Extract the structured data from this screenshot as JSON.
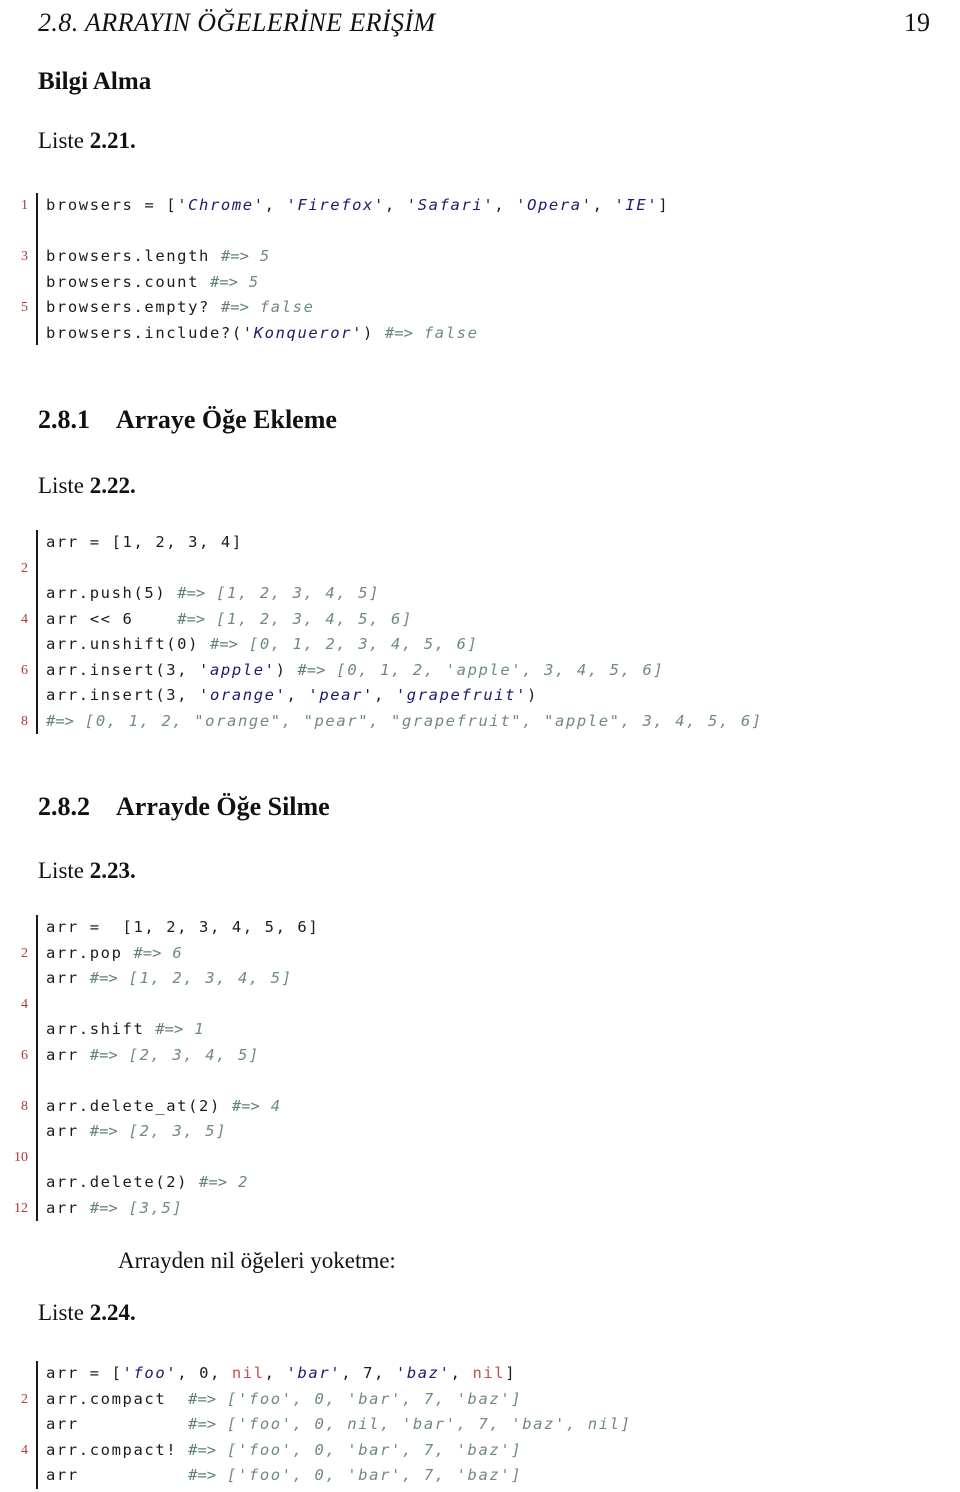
{
  "header": {
    "title": "2.8.  ARRAYIN ÖĞELERİNE ERİŞİM",
    "page_number": "19"
  },
  "colors": {
    "string": "#1b1a6e",
    "comment": "#6f8a86",
    "keyword": "#c0504d",
    "linenumber": "#b03a3a",
    "text": "#111111",
    "background": "#ffffff"
  },
  "sections": {
    "bilgi_alma_title": "Bilgi Alma",
    "listing_21_label_word": "Liste ",
    "listing_21_label_num": "2.21.",
    "subsec_1_num": "2.8.1",
    "subsec_1_title": "Arraye Öğe Ekleme",
    "listing_22_label_word": "Liste ",
    "listing_22_label_num": "2.22.",
    "subsec_2_num": "2.8.2",
    "subsec_2_title": "Arrayde Öğe Silme",
    "listing_23_label_word": "Liste ",
    "listing_23_label_num": "2.23.",
    "nil_paragraph": "Arrayden nil öğeleri yoketme:",
    "listing_24_label_word": "Liste ",
    "listing_24_label_num": "2.24."
  },
  "listing_21": {
    "lines": [
      {
        "n": "1",
        "tokens": [
          {
            "t": "browsers = [",
            "c": "plain"
          },
          {
            "t": "'Chrome'",
            "c": "str"
          },
          {
            "t": ", ",
            "c": "plain"
          },
          {
            "t": "'Firefox'",
            "c": "str"
          },
          {
            "t": ", ",
            "c": "plain"
          },
          {
            "t": "'Safari'",
            "c": "str"
          },
          {
            "t": ", ",
            "c": "plain"
          },
          {
            "t": "'Opera'",
            "c": "str"
          },
          {
            "t": ", ",
            "c": "plain"
          },
          {
            "t": "'IE'",
            "c": "str"
          },
          {
            "t": "]",
            "c": "plain"
          }
        ]
      },
      {
        "n": "",
        "tokens": []
      },
      {
        "n": "3",
        "tokens": [
          {
            "t": "browsers.length ",
            "c": "plain"
          },
          {
            "t": "#=>",
            "c": "arrow"
          },
          {
            "t": " 5",
            "c": "cmt"
          }
        ]
      },
      {
        "n": "",
        "tokens": [
          {
            "t": "browsers.count ",
            "c": "plain"
          },
          {
            "t": "#=>",
            "c": "arrow"
          },
          {
            "t": " 5",
            "c": "cmt"
          }
        ]
      },
      {
        "n": "5",
        "tokens": [
          {
            "t": "browsers.empty? ",
            "c": "plain"
          },
          {
            "t": "#=>",
            "c": "arrow"
          },
          {
            "t": " false",
            "c": "cmt"
          }
        ]
      },
      {
        "n": "",
        "tokens": [
          {
            "t": "browsers.include?(",
            "c": "plain"
          },
          {
            "t": "'Konqueror'",
            "c": "str"
          },
          {
            "t": ") ",
            "c": "plain"
          },
          {
            "t": "#=>",
            "c": "arrow"
          },
          {
            "t": " false",
            "c": "cmt"
          }
        ]
      }
    ]
  },
  "listing_22": {
    "lines": [
      {
        "n": "",
        "tokens": [
          {
            "t": "arr = [1, 2, 3, 4]",
            "c": "plain"
          }
        ]
      },
      {
        "n": "2",
        "tokens": []
      },
      {
        "n": "",
        "tokens": [
          {
            "t": "arr.push(5) ",
            "c": "plain"
          },
          {
            "t": "#=>",
            "c": "arrow"
          },
          {
            "t": " [1, 2, 3, 4, 5]",
            "c": "cmt"
          }
        ]
      },
      {
        "n": "4",
        "tokens": [
          {
            "t": "arr << 6    ",
            "c": "plain"
          },
          {
            "t": "#=>",
            "c": "arrow"
          },
          {
            "t": " [1, 2, 3, 4, 5, 6]",
            "c": "cmt"
          }
        ]
      },
      {
        "n": "",
        "tokens": [
          {
            "t": "arr.unshift(0) ",
            "c": "plain"
          },
          {
            "t": "#=>",
            "c": "arrow"
          },
          {
            "t": " [0, 1, 2, 3, 4, 5, 6]",
            "c": "cmt"
          }
        ]
      },
      {
        "n": "6",
        "tokens": [
          {
            "t": "arr.insert(3, ",
            "c": "plain"
          },
          {
            "t": "'apple'",
            "c": "str"
          },
          {
            "t": ") ",
            "c": "plain"
          },
          {
            "t": "#=>",
            "c": "arrow"
          },
          {
            "t": " [0, 1, 2, 'apple', 3, 4, 5, 6]",
            "c": "cmt"
          }
        ]
      },
      {
        "n": "",
        "tokens": [
          {
            "t": "arr.insert(3, ",
            "c": "plain"
          },
          {
            "t": "'orange'",
            "c": "str"
          },
          {
            "t": ", ",
            "c": "plain"
          },
          {
            "t": "'pear'",
            "c": "str"
          },
          {
            "t": ", ",
            "c": "plain"
          },
          {
            "t": "'grapefruit'",
            "c": "str"
          },
          {
            "t": ")",
            "c": "plain"
          }
        ]
      },
      {
        "n": "8",
        "tokens": [
          {
            "t": "#=>",
            "c": "arrow"
          },
          {
            "t": " [0, 1, 2, \"orange\", \"pear\", \"grapefruit\", \"apple\", 3, 4, 5, 6]",
            "c": "cmt"
          }
        ]
      }
    ]
  },
  "listing_23": {
    "lines": [
      {
        "n": "",
        "tokens": [
          {
            "t": "arr =  [1, 2, 3, 4, 5, 6]",
            "c": "plain"
          }
        ]
      },
      {
        "n": "2",
        "tokens": [
          {
            "t": "arr.pop ",
            "c": "plain"
          },
          {
            "t": "#=>",
            "c": "arrow"
          },
          {
            "t": " 6",
            "c": "cmt"
          }
        ]
      },
      {
        "n": "",
        "tokens": [
          {
            "t": "arr ",
            "c": "plain"
          },
          {
            "t": "#=>",
            "c": "arrow"
          },
          {
            "t": " [1, 2, 3, 4, 5]",
            "c": "cmt"
          }
        ]
      },
      {
        "n": "4",
        "tokens": []
      },
      {
        "n": "",
        "tokens": [
          {
            "t": "arr.shift ",
            "c": "plain"
          },
          {
            "t": "#=>",
            "c": "arrow"
          },
          {
            "t": " 1",
            "c": "cmt"
          }
        ]
      },
      {
        "n": "6",
        "tokens": [
          {
            "t": "arr ",
            "c": "plain"
          },
          {
            "t": "#=>",
            "c": "arrow"
          },
          {
            "t": " [2, 3, 4, 5]",
            "c": "cmt"
          }
        ]
      },
      {
        "n": "",
        "tokens": []
      },
      {
        "n": "8",
        "tokens": [
          {
            "t": "arr.delete_at(2) ",
            "c": "plain"
          },
          {
            "t": "#=>",
            "c": "arrow"
          },
          {
            "t": " 4",
            "c": "cmt"
          }
        ]
      },
      {
        "n": "",
        "tokens": [
          {
            "t": "arr ",
            "c": "plain"
          },
          {
            "t": "#=>",
            "c": "arrow"
          },
          {
            "t": " [2, 3, 5]",
            "c": "cmt"
          }
        ]
      },
      {
        "n": "10",
        "tokens": []
      },
      {
        "n": "",
        "tokens": [
          {
            "t": "arr.delete(2) ",
            "c": "plain"
          },
          {
            "t": "#=>",
            "c": "arrow"
          },
          {
            "t": " 2",
            "c": "cmt"
          }
        ]
      },
      {
        "n": "12",
        "tokens": [
          {
            "t": "arr ",
            "c": "plain"
          },
          {
            "t": "#=>",
            "c": "arrow"
          },
          {
            "t": " [3,5]",
            "c": "cmt"
          }
        ]
      }
    ]
  },
  "listing_24": {
    "lines": [
      {
        "n": "",
        "tokens": [
          {
            "t": "arr = [",
            "c": "plain"
          },
          {
            "t": "'foo'",
            "c": "str"
          },
          {
            "t": ", 0, ",
            "c": "plain"
          },
          {
            "t": "nil",
            "c": "kw"
          },
          {
            "t": ", ",
            "c": "plain"
          },
          {
            "t": "'bar'",
            "c": "str"
          },
          {
            "t": ", 7, ",
            "c": "plain"
          },
          {
            "t": "'baz'",
            "c": "str"
          },
          {
            "t": ", ",
            "c": "plain"
          },
          {
            "t": "nil",
            "c": "kw"
          },
          {
            "t": "]",
            "c": "plain"
          }
        ]
      },
      {
        "n": "2",
        "tokens": [
          {
            "t": "arr.compact  ",
            "c": "plain"
          },
          {
            "t": "#=>",
            "c": "arrow"
          },
          {
            "t": " ['foo', 0, 'bar', 7, 'baz']",
            "c": "cmt"
          }
        ]
      },
      {
        "n": "",
        "tokens": [
          {
            "t": "arr          ",
            "c": "plain"
          },
          {
            "t": "#=>",
            "c": "arrow"
          },
          {
            "t": " ['foo', 0, nil, 'bar', 7, 'baz', nil]",
            "c": "cmt"
          }
        ]
      },
      {
        "n": "4",
        "tokens": [
          {
            "t": "arr.compact! ",
            "c": "plain"
          },
          {
            "t": "#=>",
            "c": "arrow"
          },
          {
            "t": " ['foo', 0, 'bar', 7, 'baz']",
            "c": "cmt"
          }
        ]
      },
      {
        "n": "",
        "tokens": [
          {
            "t": "arr          ",
            "c": "plain"
          },
          {
            "t": "#=>",
            "c": "arrow"
          },
          {
            "t": " ['foo', 0, 'bar', 7, 'baz']",
            "c": "cmt"
          }
        ]
      }
    ]
  }
}
